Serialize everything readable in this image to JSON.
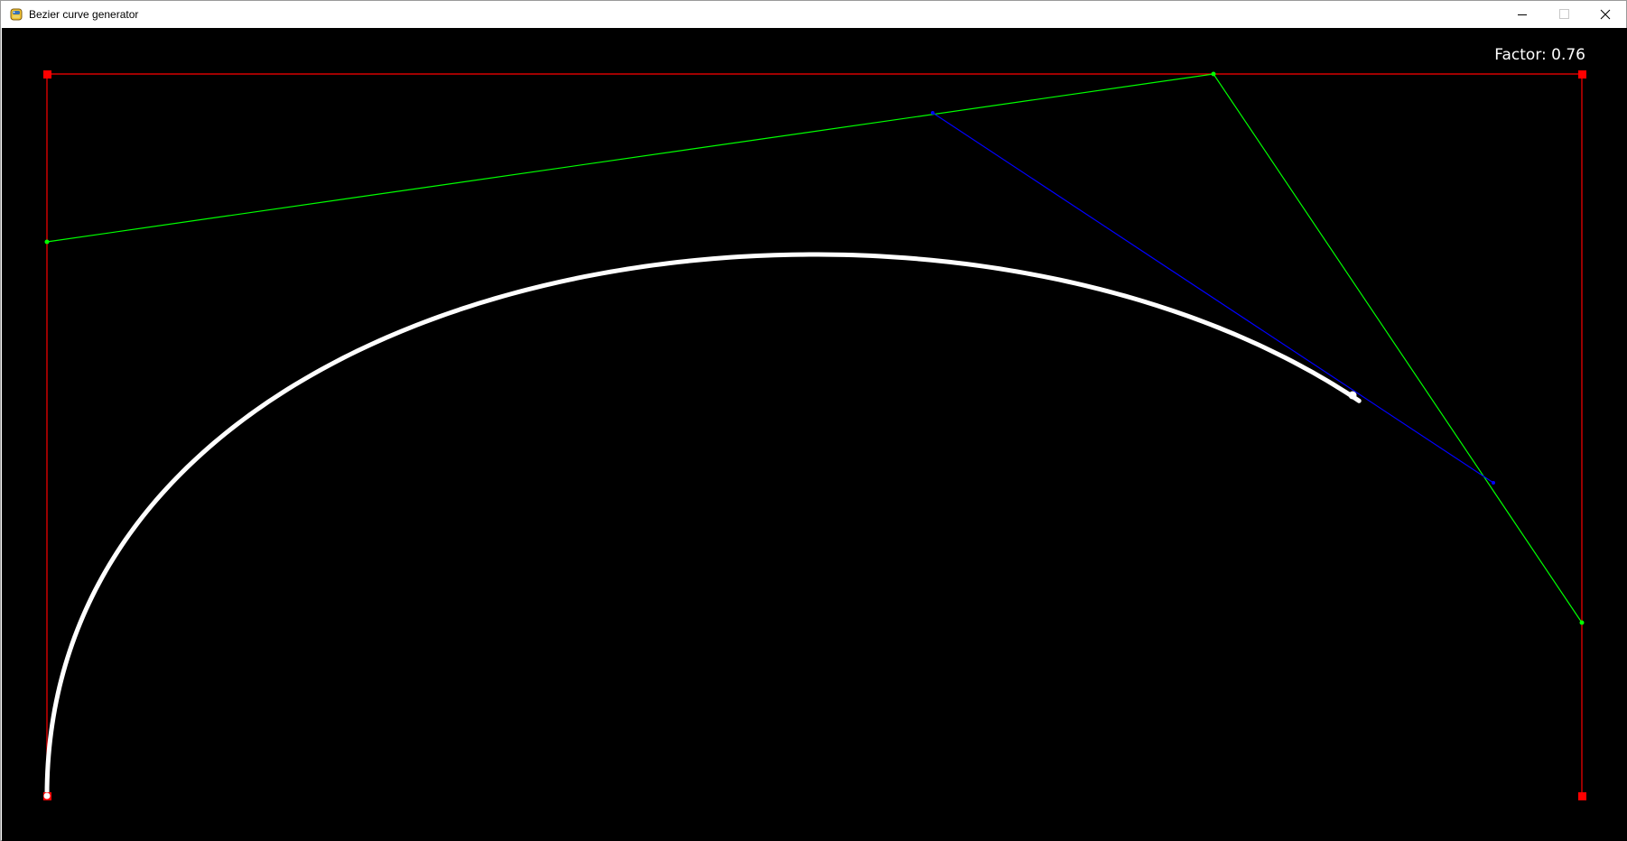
{
  "window": {
    "title": "Bezier curve generator",
    "app_icon": "python-snake-icon",
    "controls": {
      "minimize_icon": "minimize-icon",
      "maximize_icon": "maximize-icon",
      "close_icon": "close-icon"
    }
  },
  "canvas": {
    "background": "#000000",
    "factor_label": "Factor:",
    "factor_value": "0.76",
    "colors": {
      "control_polygon": "#ff0000",
      "first_level": "#00ff00",
      "second_level": "#0000ff",
      "curve": "#ffffff"
    }
  }
}
